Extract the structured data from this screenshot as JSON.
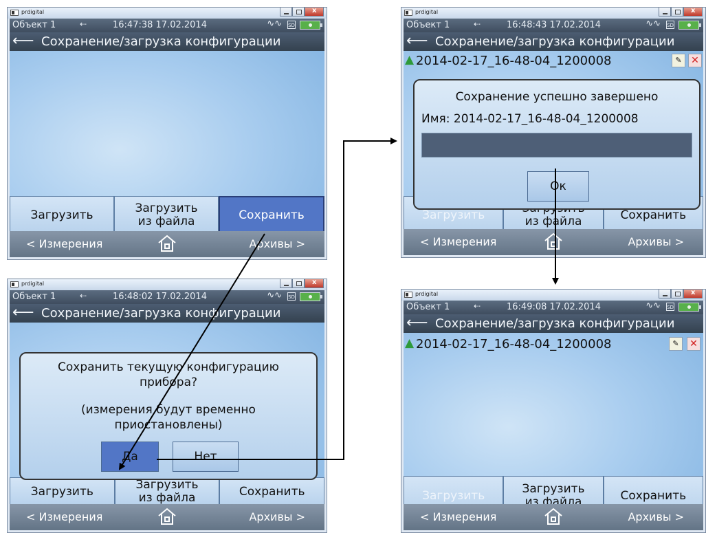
{
  "window_title": "prdigital",
  "status_object": "Объект 1",
  "screen_title": "Сохранение/загрузка конфигурации",
  "buttons": {
    "load": "Загрузить",
    "load_file_line1": "Загрузить",
    "load_file_line2": "из файла",
    "save": "Сохранить"
  },
  "nav": {
    "left": "< Измерения",
    "right": "Архивы >"
  },
  "icons": {
    "back": "left-arrow-icon",
    "usb": "usb-icon",
    "wave": "signal-wave-icon",
    "sd": "sd-card-icon",
    "battery": "battery-icon",
    "home": "home-icon",
    "file_up": "green-up-arrow-icon",
    "file_info": "file-info-icon",
    "file_delete": "delete-x-icon"
  },
  "colors": {
    "active_button": "#5276c6",
    "header_bg": "#3f4d5f",
    "screen_bg": "#a9cdef",
    "flow_arrow": "#000000"
  },
  "screens": [
    {
      "id": "screen-1",
      "time": "16:47:38",
      "date": "17.02.2014"
    },
    {
      "id": "screen-2",
      "time": "16:48:43",
      "date": "17.02.2014",
      "file_name": "2014-02-17_16-48-04_1200008",
      "dialog": {
        "title": "Сохранение успешно завершено",
        "name_line": "Имя: 2014-02-17_16-48-04_1200008",
        "ok": "Ок"
      }
    },
    {
      "id": "screen-3",
      "time": "16:48:02",
      "date": "17.02.2014",
      "dialog": {
        "line1": "Сохранить текущую конфигурацию",
        "line2": "прибора?",
        "line3": "(измерения будут временно",
        "line4": "приостановлены)",
        "yes": "Да",
        "no": "Нет"
      }
    },
    {
      "id": "screen-4",
      "time": "16:49:08",
      "date": "17.02.2014",
      "file_name": "2014-02-17_16-48-04_1200008"
    }
  ]
}
